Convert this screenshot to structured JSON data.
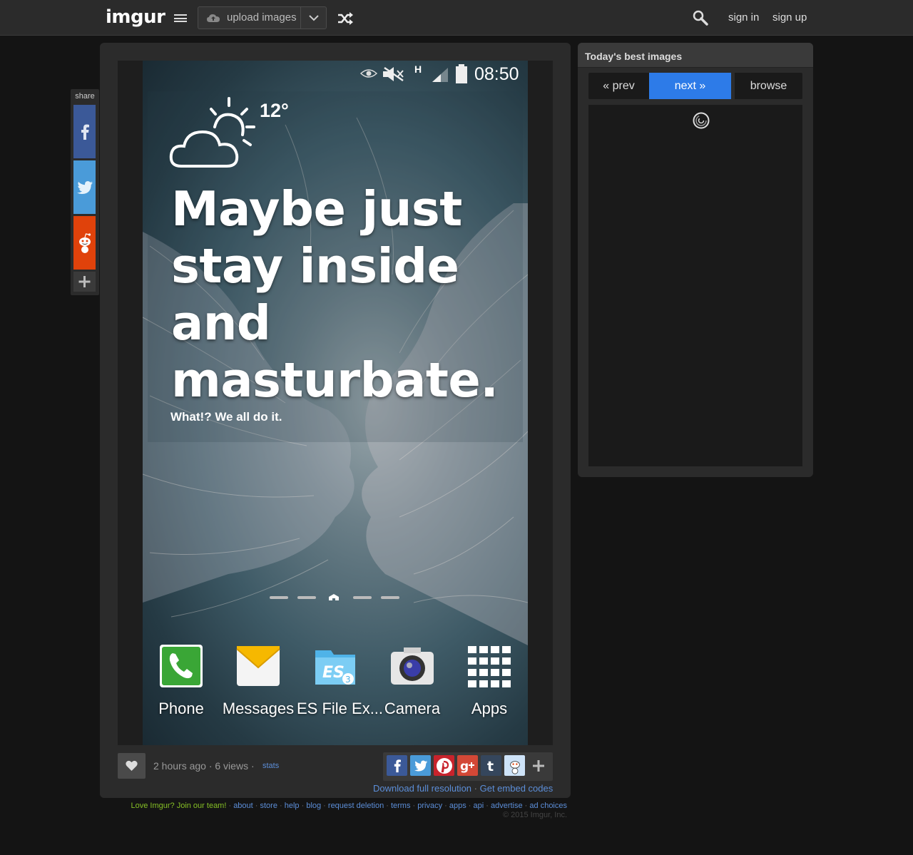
{
  "header": {
    "logo": "imgur",
    "upload_label": "upload images",
    "signin": "sign in",
    "signup": "sign up"
  },
  "share_rail": {
    "label": "share"
  },
  "image": {
    "temperature": "12°",
    "clock": "08:50",
    "network": "H",
    "quote": "Maybe just stay inside and masturbate.",
    "subtitle": "What!? We all do it.",
    "apps": [
      {
        "name": "Phone",
        "icon": "phone-icon"
      },
      {
        "name": "Messages",
        "icon": "messages-icon"
      },
      {
        "name": "ES File Ex...",
        "icon": "es-file-explorer-icon"
      },
      {
        "name": "Camera",
        "icon": "camera-icon"
      },
      {
        "name": "Apps",
        "icon": "apps-grid-icon"
      }
    ]
  },
  "meta": {
    "time": "2 hours ago · 6 views ·",
    "stats": "stats",
    "download": "Download full resolution",
    "embed": "Get embed codes"
  },
  "footer": {
    "love": "Love Imgur? Join our team!",
    "links": [
      "about",
      "store",
      "help",
      "blog",
      "request deletion",
      "terms",
      "privacy",
      "apps",
      "api",
      "advertise",
      "ad choices"
    ],
    "copyright": "© 2015 Imgur, Inc."
  },
  "side": {
    "title": "Today's best images",
    "prev": "« prev",
    "next": "next »",
    "browse": "browse"
  },
  "colors": {
    "accent": "#2d7be8",
    "logo_dot": "#85bf25",
    "facebook": "#3b5998",
    "twitter": "#4a9bd9",
    "reddit": "#e0420b",
    "link": "#5c8ed8"
  }
}
